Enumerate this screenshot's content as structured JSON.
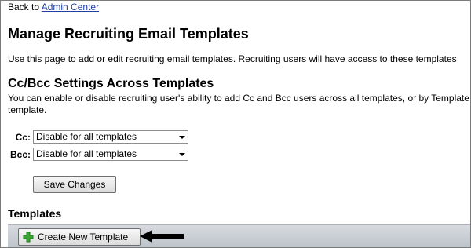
{
  "back": {
    "prefix": "Back to ",
    "link": "Admin Center"
  },
  "page_title": "Manage Recruiting Email Templates",
  "intro": "Use this page to add or edit recruiting email templates. Recruiting users will have access to these templates",
  "ccbcc": {
    "title": "Cc/Bcc Settings Across Templates",
    "description": "You can enable or disable recruiting user's ability to add Cc and Bcc users across all templates, or by Template the template.",
    "cc": {
      "label": "Cc:",
      "value": "Disable for all templates"
    },
    "bcc": {
      "label": "Bcc:",
      "value": "Disable for all templates"
    },
    "save_label": "Save Changes"
  },
  "templates": {
    "title": "Templates",
    "create_label": "Create New Template"
  },
  "icons": {
    "plus": "plus-icon",
    "pointer": "arrow-left-icon"
  },
  "colors": {
    "link": "#1f3fa5",
    "plus_green": "#3aa635",
    "toolbar": "#c9ced4"
  }
}
